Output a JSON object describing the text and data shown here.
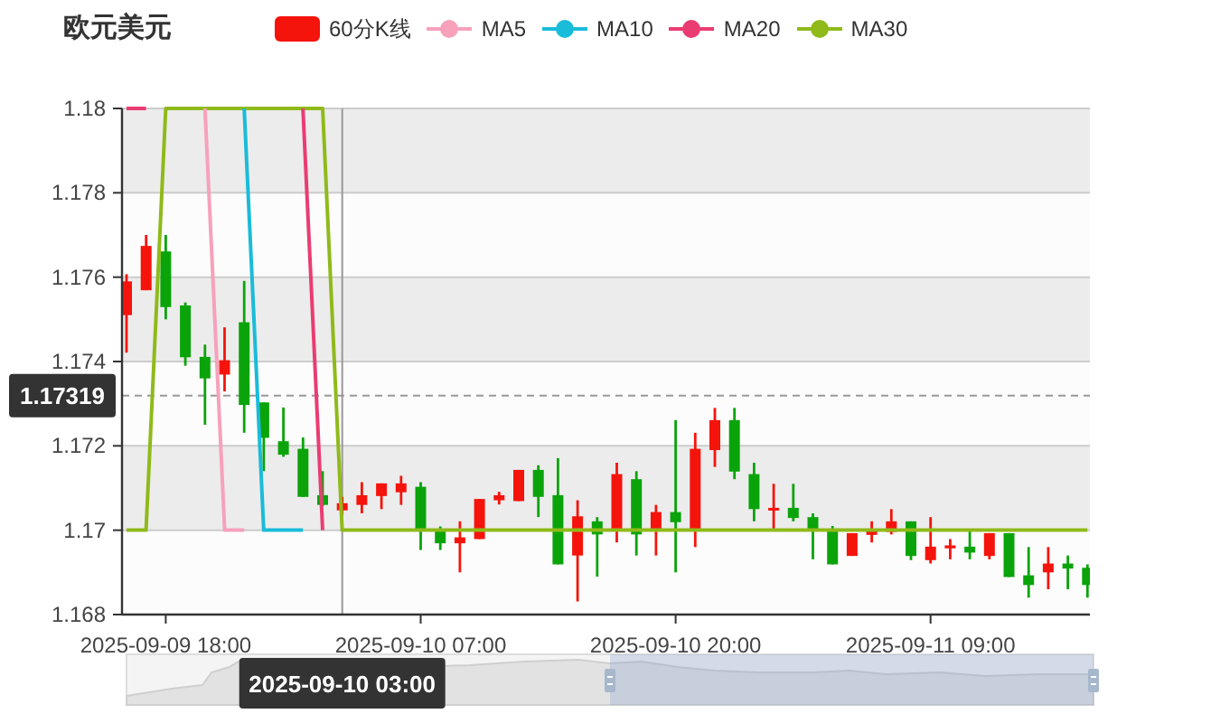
{
  "title": "欧元美元",
  "kline_legend": {
    "label": "60分K线",
    "color": "#f5140c"
  },
  "chart_data": {
    "type": "candlestick",
    "grid": true,
    "ylim": [
      1.168,
      1.18
    ],
    "yticks": [
      1.168,
      1.17,
      1.172,
      1.174,
      1.176,
      1.178,
      1.18
    ],
    "categories": [
      null,
      null,
      "2025-09-09 18:00",
      null,
      null,
      null,
      null,
      null,
      null,
      null,
      null,
      "2025-09-10 03:00",
      null,
      null,
      null,
      "2025-09-10 07:00",
      null,
      null,
      null,
      null,
      null,
      null,
      null,
      null,
      null,
      null,
      null,
      null,
      "2025-09-10 20:00",
      null,
      null,
      null,
      null,
      null,
      null,
      null,
      null,
      null,
      null,
      null,
      null,
      "2025-09-11 09:00",
      null,
      null,
      null,
      null,
      null,
      null,
      null,
      null
    ],
    "ohlc": [
      [
        1.1751,
        1.17607,
        1.17421,
        1.1759
      ],
      [
        1.17569,
        1.177,
        1.17569,
        1.17674
      ],
      [
        1.17661,
        1.177,
        1.175,
        1.17529
      ],
      [
        1.17533,
        1.1754,
        1.1739,
        1.1741
      ],
      [
        1.17411,
        1.1744,
        1.1725,
        1.1736
      ],
      [
        1.17369,
        1.17481,
        1.17329,
        1.17403
      ],
      [
        1.17493,
        1.17591,
        1.17231,
        1.17297
      ],
      [
        1.17303,
        1.17303,
        1.1714,
        1.17219
      ],
      [
        1.17211,
        1.17291,
        1.17174,
        1.17179
      ],
      [
        1.17193,
        1.1722,
        1.17079,
        1.17079
      ],
      [
        1.17083,
        1.1714,
        1.17057,
        1.1706
      ],
      [
        1.17047,
        1.17079,
        1.17036,
        1.17064
      ],
      [
        1.1706,
        1.17114,
        1.1704,
        1.17083
      ],
      [
        1.17081,
        1.17111,
        1.1705,
        1.17111
      ],
      [
        1.1709,
        1.17129,
        1.1706,
        1.17111
      ],
      [
        1.17103,
        1.17114,
        1.16953,
        1.17
      ],
      [
        1.17,
        1.17009,
        1.16953,
        1.16969
      ],
      [
        1.16969,
        1.17021,
        1.169,
        1.16983
      ],
      [
        1.16979,
        1.17074,
        1.16979,
        1.17074
      ],
      [
        1.17071,
        1.17091,
        1.17061,
        1.17083
      ],
      [
        1.17069,
        1.17143,
        1.17069,
        1.17143
      ],
      [
        1.17143,
        1.17154,
        1.17031,
        1.17079
      ],
      [
        1.17083,
        1.17171,
        1.16919,
        1.16919
      ],
      [
        1.1694,
        1.17071,
        1.16831,
        1.17033
      ],
      [
        1.17021,
        1.17031,
        1.1689,
        1.1699
      ],
      [
        1.17,
        1.1716,
        1.16971,
        1.17133
      ],
      [
        1.17121,
        1.1714,
        1.1694,
        1.1699
      ],
      [
        1.17,
        1.1706,
        1.1694,
        1.17043
      ],
      [
        1.17043,
        1.17261,
        1.169,
        1.17019
      ],
      [
        1.17,
        1.17231,
        1.1696,
        1.17193
      ],
      [
        1.1719,
        1.1729,
        1.1715,
        1.17261
      ],
      [
        1.17261,
        1.1729,
        1.17121,
        1.17139
      ],
      [
        1.17133,
        1.1716,
        1.17021,
        1.1705
      ],
      [
        1.17049,
        1.1711,
        1.17,
        1.17053
      ],
      [
        1.17053,
        1.1711,
        1.17021,
        1.17029
      ],
      [
        1.17031,
        1.1704,
        1.16931,
        1.17
      ],
      [
        1.17003,
        1.1701,
        1.16919,
        1.16919
      ],
      [
        1.16939,
        1.16993,
        1.16939,
        1.16993
      ],
      [
        1.16989,
        1.17021,
        1.16971,
        1.17001
      ],
      [
        1.16996,
        1.1705,
        1.1699,
        1.17021
      ],
      [
        1.17021,
        1.17021,
        1.16929,
        1.16939
      ],
      [
        1.16929,
        1.17031,
        1.16921,
        1.16961
      ],
      [
        1.16957,
        1.16979,
        1.16931,
        1.16964
      ],
      [
        1.16961,
        1.17,
        1.16931,
        1.16947
      ],
      [
        1.16939,
        1.16993,
        1.16931,
        1.16993
      ],
      [
        1.16993,
        1.16993,
        1.16889,
        1.16889
      ],
      [
        1.16893,
        1.1696,
        1.1684,
        1.1687
      ],
      [
        1.169,
        1.1696,
        1.1686,
        1.16921
      ],
      [
        1.16921,
        1.1694,
        1.1686,
        1.16909
      ],
      [
        1.16911,
        1.16919,
        1.1684,
        1.1687
      ]
    ],
    "series": [
      {
        "name": "MA5",
        "type": "line",
        "color": "#f7a1bb",
        "values": [
          null,
          null,
          null,
          null,
          1.18,
          1.17,
          1.17,
          null,
          null,
          null,
          null,
          null,
          null,
          null,
          null,
          null,
          null,
          null,
          null,
          null,
          null,
          null,
          null,
          null,
          null,
          null,
          null,
          null,
          null,
          null,
          null,
          null,
          null,
          null,
          null,
          null,
          null,
          null,
          null,
          null,
          null,
          null,
          null,
          null,
          null,
          null,
          null,
          null,
          null,
          null
        ]
      },
      {
        "name": "MA10",
        "type": "line",
        "color": "#19bcd9",
        "values": [
          null,
          null,
          null,
          null,
          null,
          null,
          1.18,
          1.17,
          1.17,
          1.17,
          null,
          null,
          null,
          null,
          null,
          null,
          null,
          null,
          null,
          null,
          null,
          null,
          null,
          null,
          null,
          null,
          null,
          null,
          null,
          null,
          null,
          null,
          null,
          null,
          null,
          null,
          null,
          null,
          null,
          null,
          null,
          null,
          null,
          null,
          null,
          null,
          null,
          null,
          null,
          null
        ]
      },
      {
        "name": "MA20",
        "type": "line",
        "color": "#ea3c73",
        "values": [
          1.18,
          1.18,
          null,
          null,
          null,
          null,
          null,
          null,
          null,
          1.18,
          1.17,
          null,
          null,
          null,
          null,
          null,
          null,
          null,
          null,
          null,
          null,
          null,
          null,
          null,
          null,
          null,
          null,
          null,
          null,
          null,
          null,
          null,
          null,
          null,
          null,
          null,
          null,
          null,
          null,
          null,
          null,
          null,
          null,
          null,
          null,
          null,
          null,
          null,
          null,
          null
        ]
      },
      {
        "name": "MA30",
        "type": "line",
        "color": "#8fba1a",
        "values": [
          1.17,
          1.17,
          1.18,
          1.18,
          1.18,
          1.18,
          1.18,
          1.18,
          1.18,
          1.18,
          1.18,
          1.17,
          1.17,
          1.17,
          1.17,
          1.17,
          1.17,
          1.17,
          1.17,
          1.17,
          1.17,
          1.17,
          1.17,
          1.17,
          1.17,
          1.17,
          1.17,
          1.17,
          1.17,
          1.17,
          1.17,
          1.17,
          1.17,
          1.17,
          1.17,
          1.17,
          1.17,
          1.17,
          1.17,
          1.17,
          1.17,
          1.17,
          1.17,
          1.17,
          1.17,
          1.17,
          1.17,
          1.17,
          1.17,
          1.17
        ]
      }
    ],
    "ref_lines": [
      {
        "axis": "x",
        "value": "2025-09-10 03:00"
      },
      {
        "axis": "y",
        "value": 1.17319,
        "label": "1.17319"
      }
    ]
  },
  "data_zoom": {
    "handles": [
      {
        "level": 0.5
      },
      {
        "level": 1
      }
    ]
  }
}
